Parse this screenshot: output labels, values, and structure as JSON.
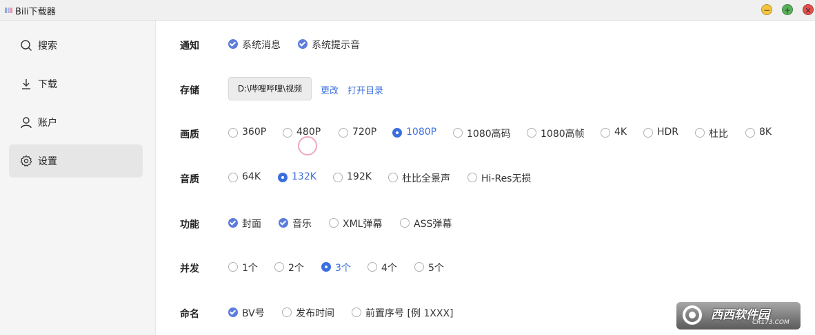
{
  "window": {
    "title": "Bili下载器",
    "min_symbol": "−",
    "max_symbol": "+",
    "close_symbol": "×",
    "icon_colors": [
      "#8fa6e8",
      "#b0b8d6",
      "#e88fb0"
    ]
  },
  "sidebar": {
    "items": [
      {
        "label": "搜索",
        "icon": "search-icon"
      },
      {
        "label": "下载",
        "icon": "download-icon"
      },
      {
        "label": "账户",
        "icon": "user-icon"
      },
      {
        "label": "设置",
        "icon": "gear-icon",
        "active": true
      }
    ]
  },
  "settings": {
    "notify": {
      "label": "通知",
      "options": [
        {
          "label": "系统消息",
          "checked": true
        },
        {
          "label": "系统提示音",
          "checked": true
        }
      ]
    },
    "storage": {
      "label": "存储",
      "path": "D:\\哔哩哔哩\\视频",
      "change": "更改",
      "open": "打开目录"
    },
    "quality": {
      "label": "画质",
      "options": [
        "360P",
        "480P",
        "720P",
        "1080P",
        "1080高码",
        "1080高帧",
        "4K",
        "HDR",
        "杜比",
        "8K"
      ],
      "selected": "1080P"
    },
    "audio": {
      "label": "音质",
      "options": [
        "64K",
        "132K",
        "192K",
        "杜比全景声",
        "Hi-Res无损"
      ],
      "selected": "132K"
    },
    "features": {
      "label": "功能",
      "options": [
        {
          "label": "封面",
          "checked": true
        },
        {
          "label": "音乐",
          "checked": true
        },
        {
          "label": "XML弹幕",
          "checked": false
        },
        {
          "label": "ASS弹幕",
          "checked": false
        }
      ]
    },
    "concurrency": {
      "label": "并发",
      "options": [
        "1个",
        "2个",
        "3个",
        "4个",
        "5个"
      ],
      "selected": "3个"
    },
    "naming": {
      "label": "命名",
      "options": [
        {
          "label": "BV号",
          "checked": true
        },
        {
          "label": "发布时间",
          "checked": false
        },
        {
          "label": "前置序号 [例 1XXX]",
          "checked": false
        }
      ]
    }
  },
  "watermark": {
    "text": "西西软件园",
    "sub": "CR173.COM"
  },
  "colors": {
    "accent": "#3b6fe0",
    "check": "#5b7ddc",
    "sidebar_bg": "#f5f5f5",
    "active_bg": "#e6e6e6"
  }
}
